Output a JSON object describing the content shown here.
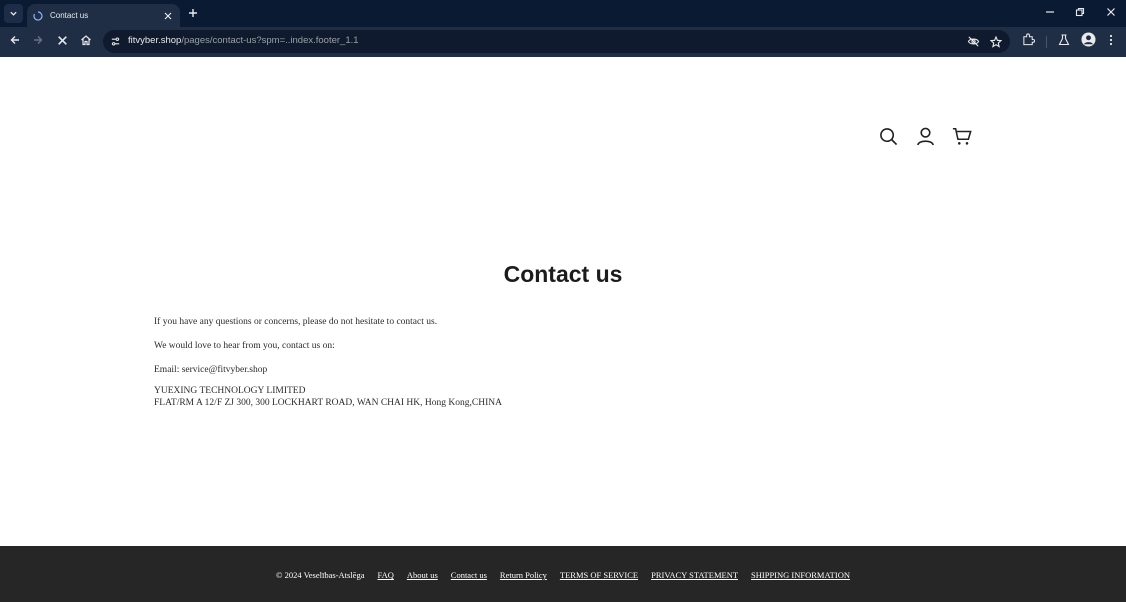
{
  "browser": {
    "tab": {
      "title": "Contact us"
    },
    "address": {
      "domain": "fitvyber.shop",
      "path": "/pages/contact-us?spm=..index.footer_1.1"
    }
  },
  "icons": {
    "tab_list": "chevron-down-icon",
    "favicon": "loading-favicon-icon",
    "tab_close": "close-icon",
    "new_tab": "plus-icon",
    "minimize": "minimize-icon",
    "restore": "restore-icon",
    "close_window": "close-icon",
    "back": "back-arrow-icon",
    "forward": "forward-arrow-icon",
    "stop": "stop-loading-icon",
    "home": "home-icon",
    "site_info": "site-settings-icon",
    "tracking": "eye-off-icon",
    "bookmark": "star-icon",
    "extensions": "puzzle-icon",
    "labs": "flask-icon",
    "profile": "profile-icon",
    "menu": "kebab-menu-icon",
    "search": "search-icon",
    "account": "user-icon",
    "cart": "cart-icon"
  },
  "page": {
    "title": "Contact us",
    "paragraphs": {
      "intro": "If you have any questions or concerns, please do not hesitate to contact us.",
      "love": "We would love to hear from you, contact us on:",
      "email": "Email: service@fitvyber.shop",
      "company": "YUEXING TECHNOLOGY LIMITED",
      "address": "FLAT/RM A 12/F ZJ 300, 300 LOCKHART ROAD, WAN CHAI HK, Hong Kong,CHINA"
    }
  },
  "footer": {
    "copyright": "© 2024 Veselības-Atslēga",
    "links": [
      "FAQ",
      "About us",
      "Contact us",
      "Return Policy",
      "TERMS OF SERVICE",
      "PRIVACY STATEMENT",
      "SHIPPING INFORMATION"
    ]
  },
  "colors": {
    "chrome_dark": "#0b1a33",
    "chrome_toolbar": "#1f2d45",
    "footer_bg": "#262626",
    "text": "#2b2b2b"
  }
}
